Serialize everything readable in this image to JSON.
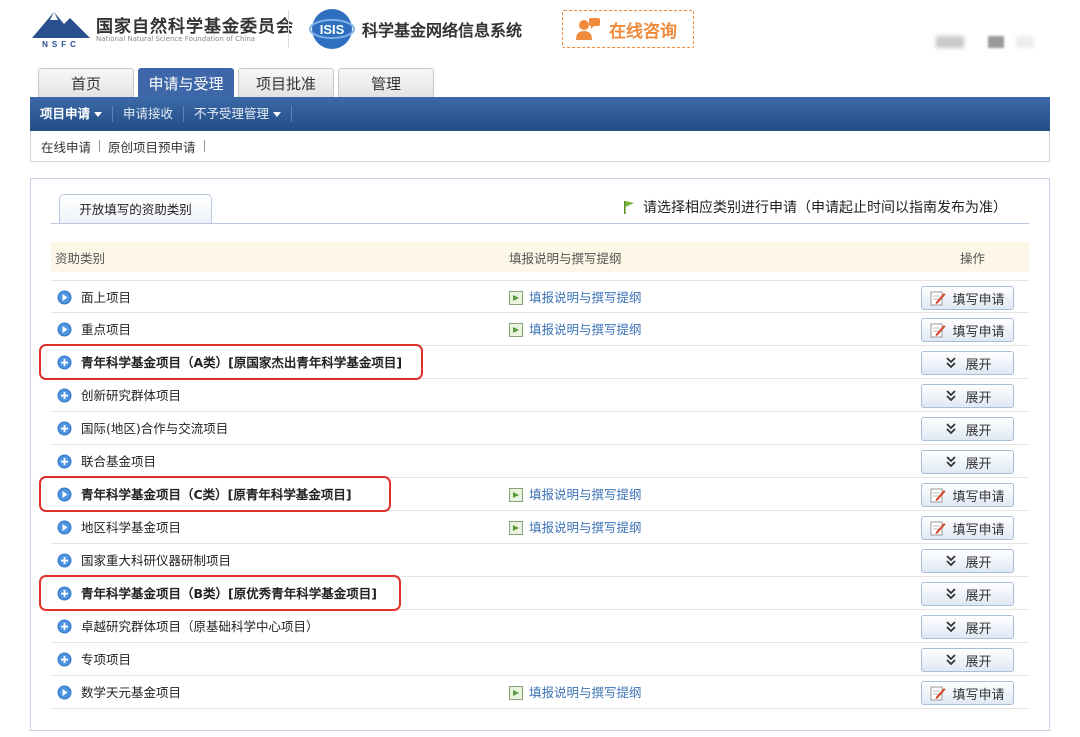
{
  "header": {
    "org_name_cn": "国家自然科学基金委员会",
    "org_name_en": "National Natural Science Foundation of China",
    "logo_text": "NSFC",
    "system_logo_text": "ISIS",
    "system_title": "科学基金网络信息系统",
    "consult_label": "在线咨询"
  },
  "tabs": [
    {
      "label": "首页",
      "active": false
    },
    {
      "label": "申请与受理",
      "active": true
    },
    {
      "label": "项目批准",
      "active": false
    },
    {
      "label": "管理",
      "active": false
    }
  ],
  "nav": {
    "items": [
      {
        "label": "项目申请",
        "has_dropdown": true,
        "active": true
      },
      {
        "label": "申请接收",
        "has_dropdown": false,
        "active": false
      },
      {
        "label": "不予受理管理",
        "has_dropdown": true,
        "active": false
      }
    ]
  },
  "subnav": {
    "items": [
      "在线申请",
      "原创项目预申请"
    ]
  },
  "panel": {
    "tab_label": "开放填写的资助类别",
    "notice": "请选择相应类别进行申请（申请起止时间以指南发布为准）",
    "columns": {
      "category": "资助类别",
      "guide": "填报说明与撰写提纲",
      "action": "操作"
    },
    "guide_link_label": "填报说明与撰写提纲",
    "fill_label": "填写申请",
    "expand_label": "展开",
    "rows": [
      {
        "name": "面上项目",
        "bullet": "arrow",
        "has_guide": true,
        "action": "fill",
        "highlighted": false
      },
      {
        "name": "重点项目",
        "bullet": "arrow",
        "has_guide": true,
        "action": "fill",
        "highlighted": false
      },
      {
        "name": "青年科学基金项目（A类）[原国家杰出青年科学基金项目]",
        "bullet": "plus",
        "has_guide": false,
        "action": "expand",
        "highlighted": true
      },
      {
        "name": "创新研究群体项目",
        "bullet": "plus",
        "has_guide": false,
        "action": "expand",
        "highlighted": false
      },
      {
        "name": "国际(地区)合作与交流项目",
        "bullet": "plus",
        "has_guide": false,
        "action": "expand",
        "highlighted": false
      },
      {
        "name": "联合基金项目",
        "bullet": "plus",
        "has_guide": false,
        "action": "expand",
        "highlighted": false
      },
      {
        "name": "青年科学基金项目（C类）[原青年科学基金项目]",
        "bullet": "arrow",
        "has_guide": true,
        "action": "fill",
        "highlighted": true
      },
      {
        "name": "地区科学基金项目",
        "bullet": "arrow",
        "has_guide": true,
        "action": "fill",
        "highlighted": false
      },
      {
        "name": "国家重大科研仪器研制项目",
        "bullet": "plus",
        "has_guide": false,
        "action": "expand",
        "highlighted": false
      },
      {
        "name": "青年科学基金项目（B类）[原优秀青年科学基金项目]",
        "bullet": "plus",
        "has_guide": false,
        "action": "expand",
        "highlighted": true
      },
      {
        "name": "卓越研究群体项目（原基础科学中心项目）",
        "bullet": "plus",
        "has_guide": false,
        "action": "expand",
        "highlighted": false
      },
      {
        "name": "专项项目",
        "bullet": "plus",
        "has_guide": false,
        "action": "expand",
        "highlighted": false
      },
      {
        "name": "数学天元基金项目",
        "bullet": "arrow",
        "has_guide": true,
        "action": "fill",
        "highlighted": false
      }
    ]
  },
  "colors": {
    "nav_blue": "#2d5a96",
    "highlight_red": "#e0312d",
    "consult_orange": "#f08a3c",
    "link_blue": "#3d73b6"
  }
}
